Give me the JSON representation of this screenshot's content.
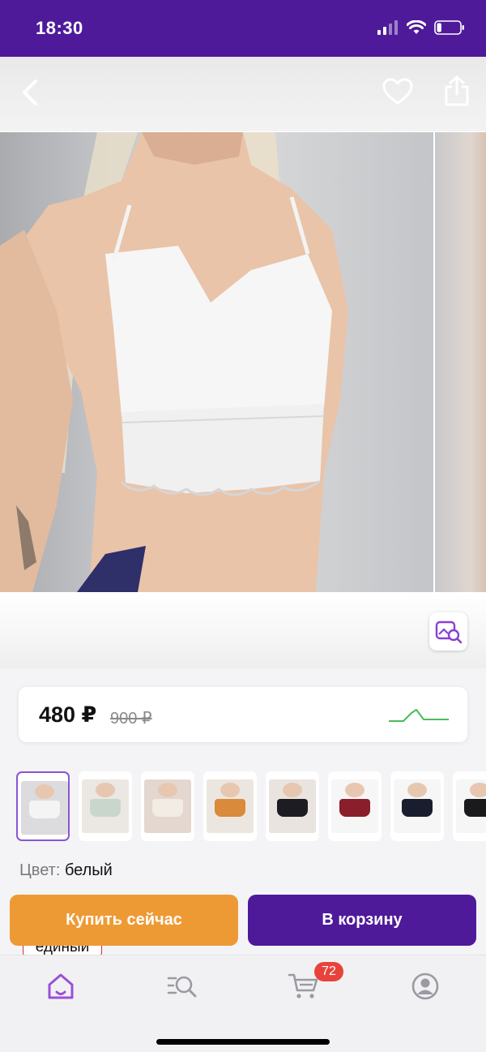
{
  "status_bar": {
    "time": "18:30",
    "battery_level": 0.2
  },
  "nav": {
    "back_icon": "chevron-left-icon",
    "favorite_icon": "heart-icon",
    "share_icon": "share-icon"
  },
  "product": {
    "price_current": "480 ₽",
    "price_old": "900 ₽",
    "trend_color": "#4cbb5a",
    "color_label": "Цвет:",
    "color_value": "белый",
    "size_value": "единый"
  },
  "variants": [
    {
      "selected": true,
      "bg": "#dcdcde",
      "item": "#f4f4f4"
    },
    {
      "selected": false,
      "bg": "#ebe7e2",
      "item": "#c9d6cc"
    },
    {
      "selected": false,
      "bg": "#e4d7cf",
      "item": "#f2ece4"
    },
    {
      "selected": false,
      "bg": "#ece6e0",
      "item": "#d98a3a"
    },
    {
      "selected": false,
      "bg": "#e9e4df",
      "item": "#1c1c22"
    },
    {
      "selected": false,
      "bg": "#f6f6f6",
      "item": "#8a1e2a"
    },
    {
      "selected": false,
      "bg": "#f6f6f6",
      "item": "#1a1d2e"
    },
    {
      "selected": false,
      "bg": "#f6f6f6",
      "item": "#1a1a1c"
    }
  ],
  "actions": {
    "buy_now": "Купить сейчас",
    "add_to_cart": "В корзину"
  },
  "tab_bar": {
    "items": [
      {
        "name": "home",
        "icon": "home-icon",
        "active": true
      },
      {
        "name": "catalog",
        "icon": "catalog-search-icon",
        "active": false
      },
      {
        "name": "cart",
        "icon": "cart-icon",
        "active": false
      },
      {
        "name": "profile",
        "icon": "profile-icon",
        "active": false
      }
    ],
    "cart_count": "72"
  },
  "colors": {
    "brand": "#4e1a9a",
    "accent_orange": "#ee9a34",
    "badge_red": "#e8433a",
    "tab_active": "#9b4fd6"
  }
}
